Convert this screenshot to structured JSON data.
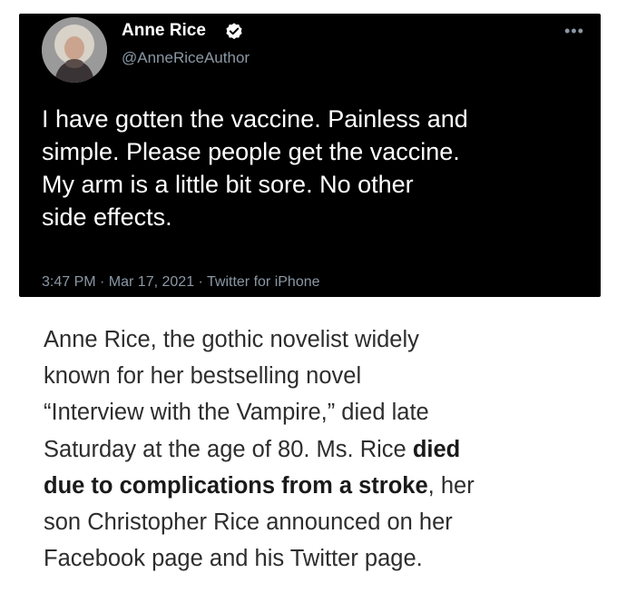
{
  "tweet": {
    "author_name": "Anne Rice",
    "handle": "@AnneRiceAuthor",
    "more_icon": "more-horizontal-icon",
    "verified_icon": "verified-badge-icon",
    "text_lines": [
      "I have gotten the vaccine. Painless and",
      "simple. Please people get the vaccine.",
      "My arm is a little bit sore.  No other",
      "side effects."
    ],
    "meta": "3:47 PM · Mar 17, 2021 · Twitter for iPhone",
    "colors": {
      "background": "#000000",
      "text": "#ffffff",
      "secondary": "#8b98a5"
    }
  },
  "article": {
    "line1": "Anne Rice, the gothic novelist widely",
    "line2": "known for her bestselling novel",
    "line3": "“Interview with the Vampire,” died late",
    "line4_normal": "Saturday at the age of 80. Ms. Rice ",
    "line4_bold": "died",
    "line5_bold": "due to complications from a stroke",
    "line5_normal": ", her",
    "line6": "son Christopher Rice announced on her",
    "line7": "Facebook page and his Twitter page."
  }
}
